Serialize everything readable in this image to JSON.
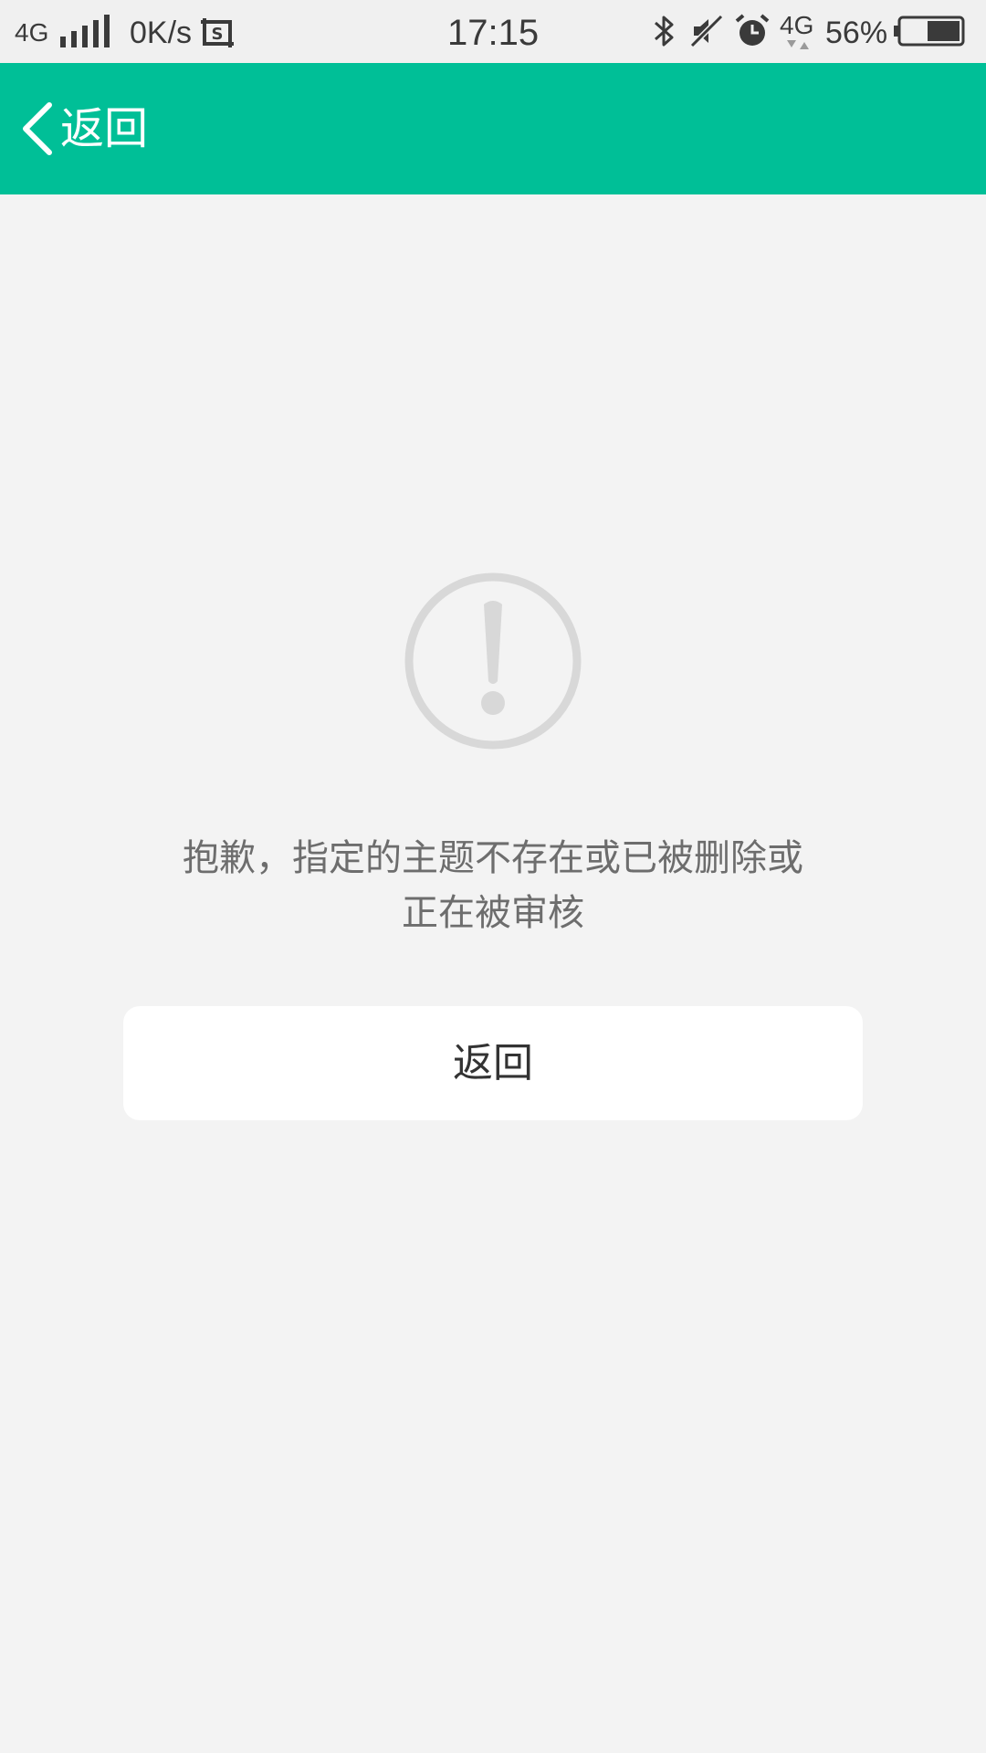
{
  "status_bar": {
    "network_left": "4G",
    "speed": "0K/s",
    "time": "17:15",
    "network_right": "4G",
    "battery_percent": "56%",
    "battery_level": 0.56,
    "icons": [
      "signal-icon",
      "screenshot-icon",
      "bluetooth-icon",
      "mute-icon",
      "alarm-icon",
      "battery-icon"
    ]
  },
  "header": {
    "back_label": "返回",
    "background_color": "#00bf97"
  },
  "main": {
    "icon": "warning-icon",
    "message_line1": "抱歉，指定的主题不存在或已被删除或",
    "message_line2": "正在被审核",
    "return_button_label": "返回"
  }
}
